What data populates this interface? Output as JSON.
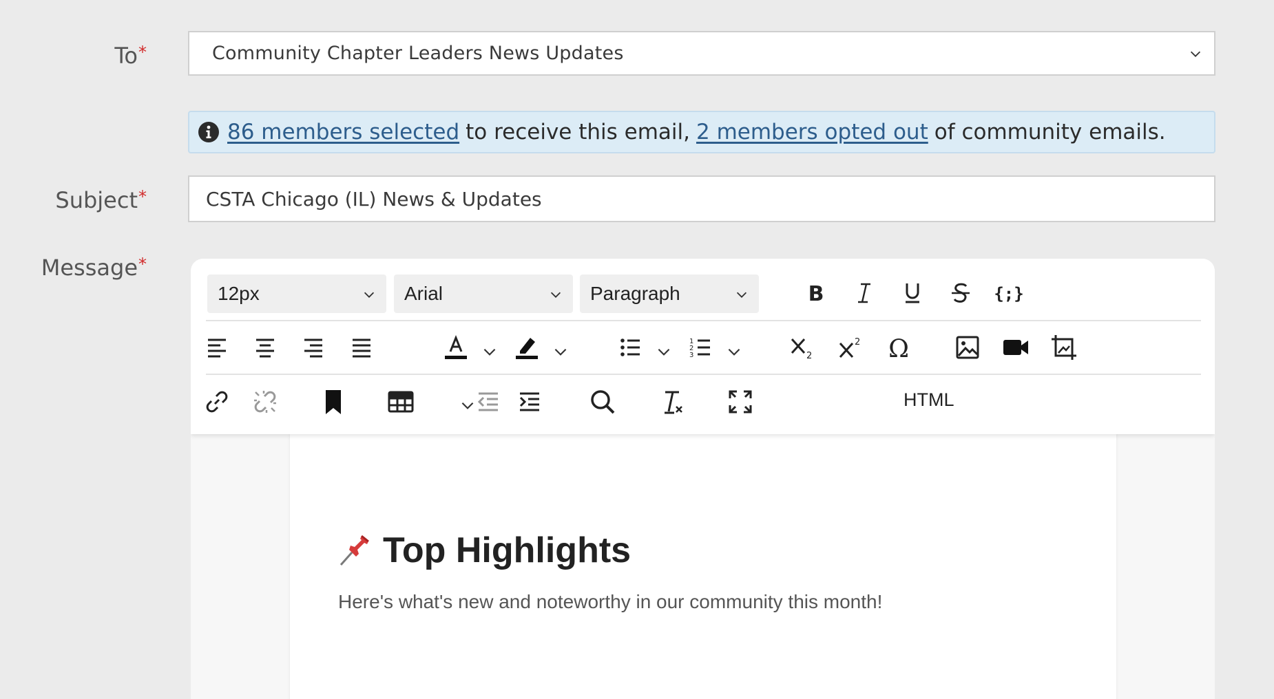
{
  "form": {
    "to": {
      "label": "To",
      "required_mark": "*",
      "value": "Community Chapter Leaders News Updates"
    },
    "info": {
      "members_selected_link": "86 members selected",
      "middle_text": "to receive this email,",
      "opted_out_link": "2 members opted out",
      "end_text": "of community emails."
    },
    "subject": {
      "label": "Subject",
      "required_mark": "*",
      "value": "CSTA Chicago (IL) News & Updates"
    },
    "message": {
      "label": "Message",
      "required_mark": "*"
    }
  },
  "toolbar": {
    "font_size": "12px",
    "font_family": "Arial",
    "block_format": "Paragraph",
    "html_label": "HTML",
    "icons": {
      "row1": [
        "bold-icon",
        "italic-icon",
        "underline-icon",
        "strikethrough-icon",
        "code-braces-icon"
      ],
      "row2": [
        "align-left-icon",
        "align-center-icon",
        "align-right-icon",
        "align-justify-icon",
        "text-color-icon",
        "highlight-color-icon",
        "bullet-list-icon",
        "numbered-list-icon",
        "subscript-icon",
        "superscript-icon",
        "special-character-icon",
        "insert-image-icon",
        "insert-video-icon",
        "image-crop-icon"
      ],
      "row3": [
        "insert-link-icon",
        "unlink-icon",
        "bookmark-icon",
        "insert-table-icon",
        "outdent-icon",
        "indent-icon",
        "search-icon",
        "clear-formatting-icon",
        "fullscreen-icon"
      ]
    }
  },
  "content": {
    "heading_icon": "pushpin-icon",
    "heading": "Top Highlights",
    "paragraph": "Here's what's new and noteworthy in our community this month!"
  },
  "colors": {
    "background": "#ebebeb",
    "required": "#d12b2b",
    "link": "#2d5d8c",
    "info_bg": "#dcecf6",
    "pin": "#d63b3b"
  }
}
